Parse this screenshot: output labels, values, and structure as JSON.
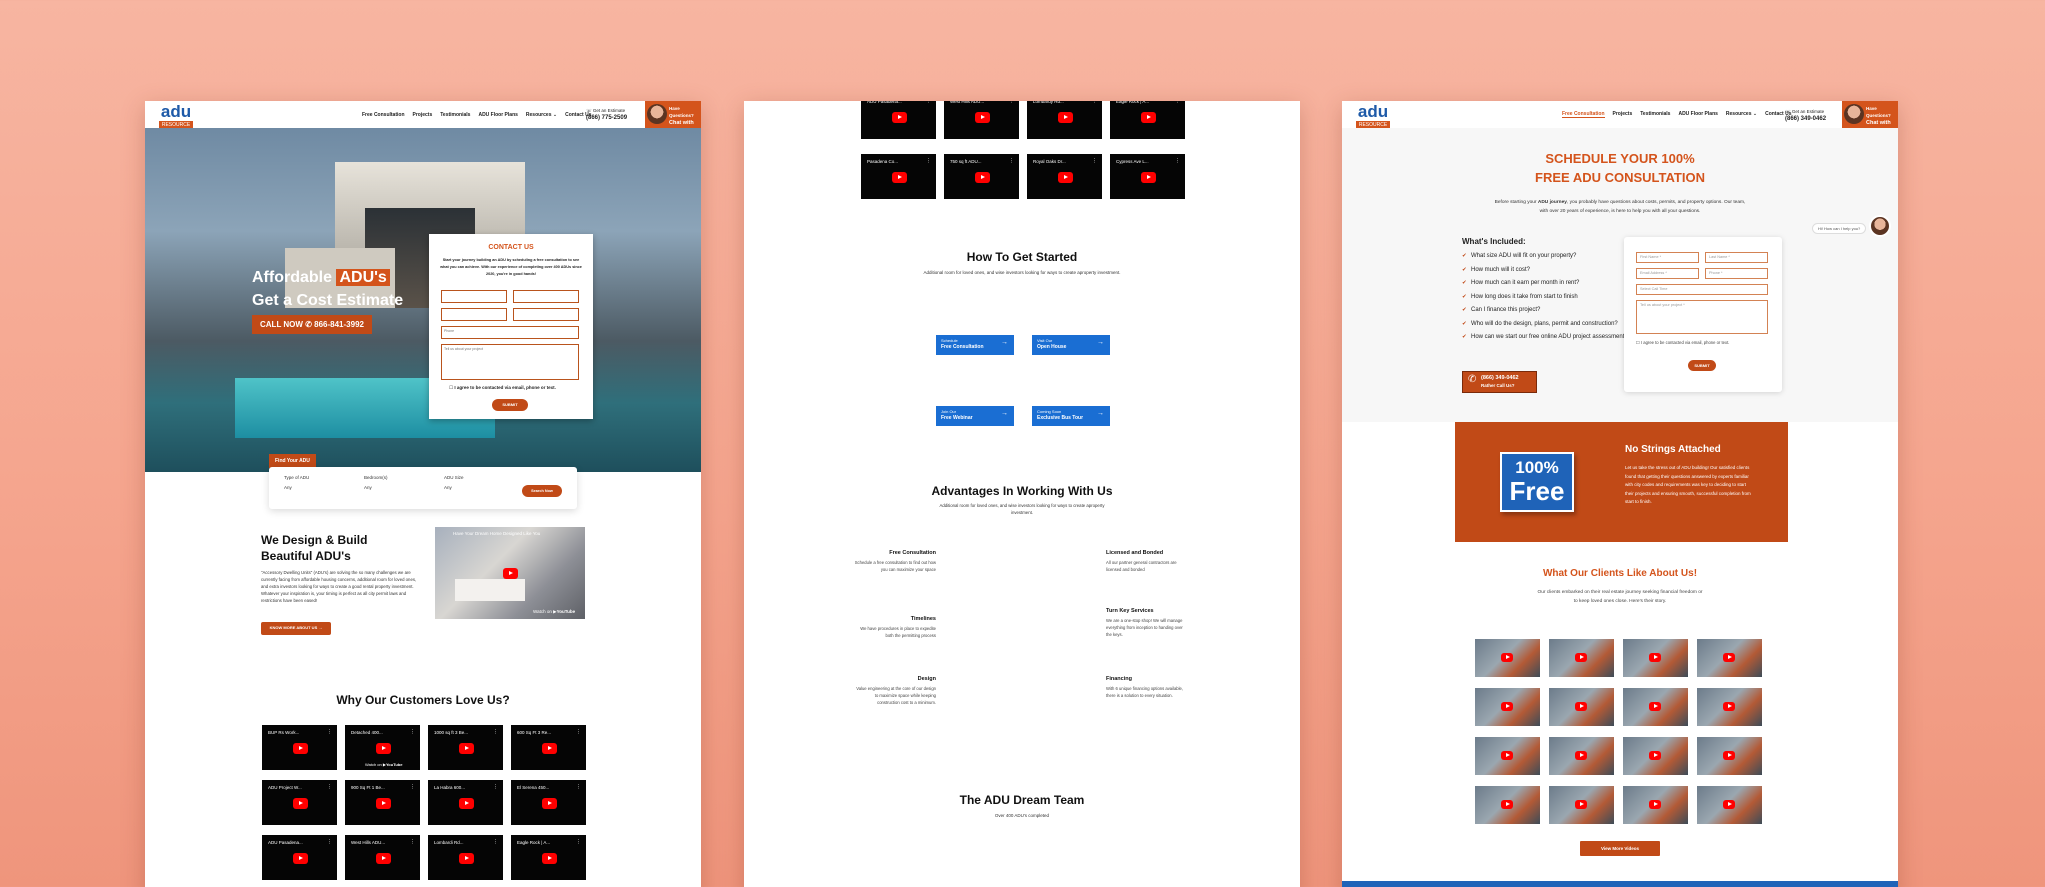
{
  "panel1": {
    "logo": {
      "top": "adu",
      "bottom": "RESOURCE CENTER"
    },
    "nav": [
      "Free Consultation",
      "Projects",
      "Testimonials",
      "ADU Floor Plans",
      "Resources",
      "Contact Us"
    ],
    "nav_chevron": "⌄",
    "estimate_label": "Get an Estimate",
    "phone": "(866) 775-2509",
    "chat_top": "Have Questions?",
    "chat_bottom": "Chat with us!",
    "hero_line1_pre": "Affordable ",
    "hero_line1_hl": "ADU's",
    "hero_line2": "Get a Cost Estimate",
    "call_label": "CALL NOW",
    "call_phone": "866-841-3992",
    "form": {
      "title": "CONTACT US",
      "intro": "Start your journey building an ADU by scheduling a free consultation to see what you can achieve. With our experience of completing over 400 ADUs since 2020, you're in good hands!",
      "phone_placeholder": "Phone",
      "message_placeholder": "Tell us about your project",
      "consent": "I agree to be contacted via email, phone or text.",
      "submit": "SUBMIT"
    },
    "find": {
      "tab": "Find Your ADU",
      "cols": [
        {
          "label": "Type of ADU",
          "value": "Any"
        },
        {
          "label": "Bedroom(s)",
          "value": "Any"
        },
        {
          "label": "ADU Size",
          "value": "Any"
        }
      ],
      "button": "Search Now"
    },
    "design": {
      "title_l1": "We Design & Build",
      "title_l2": "Beautiful ADU's",
      "body": "\"Accessory Dwelling Units\" (ADU's) are solving the so many challenges we are currently facing from affordable housing concerns, additional room for loved ones, and extra investors looking for ways to create a good rental property investment. Whatever your inspiration is, your timing is perfect as all city permit laws and restrictions have been eased!",
      "button": "KNOW MORE ABOUT US",
      "video_title": "Have Your Dream Home Designed Like You",
      "watch_on": "Watch on",
      "youtube": "YouTube"
    },
    "love_title": "Why Our Customers Love Us?",
    "videos": [
      "BUP Rs Work...",
      "Detached 400...",
      "1000 sq ft 3 Be...",
      "600 Sq Ft 3 Re...",
      "ADU Project W...",
      "900 Sq Ft 1 Be...",
      "La Habra 600...",
      "El Serena 450...",
      "ADU Pasadena...",
      "West Hills ADU...",
      "Lombardi Rd...",
      "Eagle Rock | A..."
    ],
    "watch_on": "Watch on",
    "youtube": "YouTube"
  },
  "panel2": {
    "top_videos": [
      "ADU Pasadena...",
      "West Hills ADU...",
      "Lombardy Rd...",
      "Eagle Rock | A...",
      "Pasadena Co...",
      "750 sq ft ADU...",
      "Royal Oaks Dr...",
      "Cypress Ave L..."
    ],
    "started_title": "How To Get Started",
    "started_sub": "Additional room for loved ones, and wise investors looking for ways to create aproperty investment.",
    "buttons": [
      {
        "small": "Schedule",
        "big": "Free Consultation"
      },
      {
        "small": "Visit Our",
        "big": "Open House"
      },
      {
        "small": "Join Our",
        "big": "Free Webinar"
      },
      {
        "small": "Coming Soon",
        "big": "Exclusive Bus Tour"
      }
    ],
    "arrow": "→",
    "adv_title": "Advantages In Working With Us",
    "adv_sub": "Additional room for loved ones, and wise investors looking for ways to create aproperty investment.",
    "advantages": [
      {
        "title": "Free Consultation",
        "body": "Schedule a free consultation to find out how you can maximize your space"
      },
      {
        "title": "Licensed and Bonded",
        "body": "All our partner general contractors are licensed and bonded"
      },
      {
        "title": "Timelines",
        "body": "We have procedures in place to expedite both the permitting process"
      },
      {
        "title": "Turn Key Services",
        "body": "We are a one-stop shop! We will manage everything from inception to handing over the keys."
      },
      {
        "title": "Design",
        "body": "Value engineering at the core of our design to maximize space while keeping construction cost to a minimum."
      },
      {
        "title": "Financing",
        "body": "With 6 unique financing options available, there is a solution to every situation."
      }
    ],
    "team_title": "The ADU Dream Team",
    "team_sub": "Over 400 ADU's completed"
  },
  "panel3": {
    "nav": [
      "Free Consultation",
      "Projects",
      "Testimonials",
      "ADU Floor Plans",
      "Resources",
      "Contact Us"
    ],
    "estimate_label": "Get an Estimate",
    "phone": "(866) 349-0462",
    "title_l1": "SCHEDULE YOUR 100%",
    "title_l2": "FREE ADU CONSULTATION",
    "intro_pre": "Before starting your ",
    "intro_bold": "ADU journey",
    "intro_post": ", you probably have questions about costs, permits, and property options. Our team, with over 20 years of experience, is here to help you with all your questions.",
    "help_bubble": "Hi! How can I help you?",
    "included_title": "What's Included:",
    "included": [
      "What size ADU will fit on your property?",
      "How much will it cost?",
      "How much can it earn per month in rent?",
      "How long does it take from start to finish",
      "Can I finance this project?",
      "Who will do the design, plans, permit and construction?",
      "How can we start our free online ADU project assessment?"
    ],
    "call_phone": "(866) 349-0462",
    "call_sub": "Rather Call Us?",
    "form": {
      "first": "First Name *",
      "last": "Last Name *",
      "email": "Email Address *",
      "phone": "Phone *",
      "time": "Select Call Time",
      "message": "Tell us about your project *",
      "consent": "I agree to be contacted via email, phone or text.",
      "submit": "SUBMIT"
    },
    "free_badge_top": "100%",
    "free_badge_bottom": "Free",
    "nostrings_title": "No Strings Attached",
    "nostrings_body": "Let us take the stress out of ADU building! Our satisfied clients found that getting their questions answered by experts familiar with city codes and requirements was key to deciding to start their projects and ensuring smooth, successful completion from start to finish.",
    "clients_title": "What Our Clients Like About Us!",
    "clients_sub": "Our clients embarked on their real estate journey seeking financial freedom or to keep loved ones close. Here's their story.",
    "more_videos": "View More Videos"
  },
  "colors": {
    "brand_orange": "#d4541c",
    "brand_blue": "#1e5aa8",
    "button_blue": "#1a6ed3",
    "background": "#f5a58e"
  }
}
